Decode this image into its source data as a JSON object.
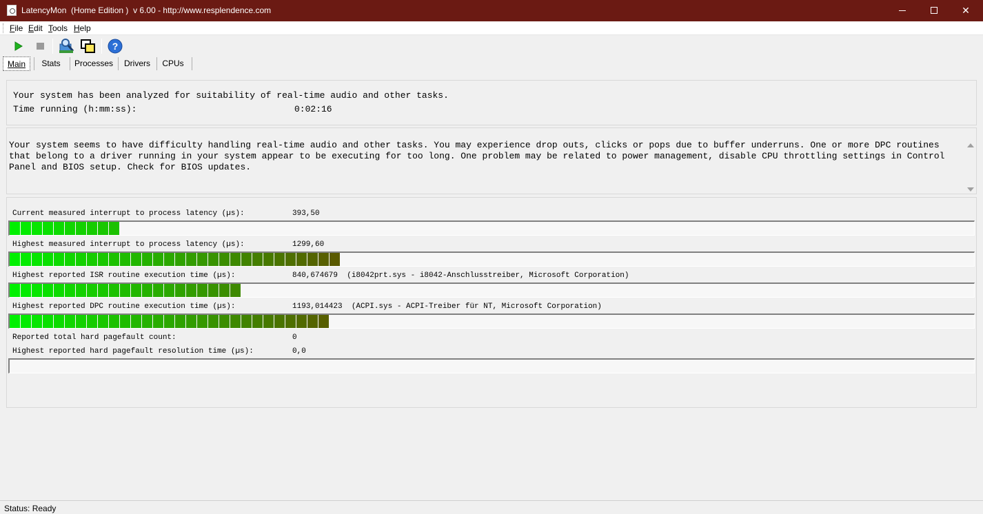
{
  "window": {
    "title": "LatencyMon  (Home Edition )  v 6.00 - http://www.resplendence.com",
    "close_glyph": "✕"
  },
  "menu": [
    {
      "underline": "F",
      "rest": "ile"
    },
    {
      "underline": "E",
      "rest": "dit"
    },
    {
      "underline": "T",
      "rest": "ools"
    },
    {
      "underline": "H",
      "rest": "elp"
    }
  ],
  "toolbar": {
    "icons": [
      "play-icon",
      "stop-icon",
      "analyze-icon",
      "windows-icon",
      "help-icon"
    ],
    "help_glyph": "?"
  },
  "tabs": [
    {
      "label": "Main",
      "active": true
    },
    {
      "label": "Stats",
      "active": false
    },
    {
      "label": "Processes",
      "active": false
    },
    {
      "label": "Drivers",
      "active": false
    },
    {
      "label": "CPUs",
      "active": false
    }
  ],
  "summary": {
    "line1": "Your system has been analyzed for suitability of real-time audio and other tasks.",
    "time_label": "Time running (h:mm:ss):",
    "time_value": "0:02:16"
  },
  "message": "Your system seems to have difficulty handling real-time audio and other tasks. You may experience drop outs, clicks or pops due to buffer underruns. One or more DPC routines that belong to a driver running in your system appear to be executing for too long. One problem may be related to power management, disable CPU throttling settings in Control Panel and BIOS setup. Check for BIOS updates.",
  "stats": {
    "current_latency": {
      "label": "Current measured interrupt to process latency (µs):",
      "value": "393,50",
      "segments": 10
    },
    "highest_latency": {
      "label": "Highest measured interrupt to process latency (µs):",
      "value": "1299,60",
      "segments": 30
    },
    "isr": {
      "label": "Highest reported ISR routine execution time (µs):",
      "value": "840,674679  (i8042prt.sys - i8042-Anschlusstreiber, Microsoft Corporation)",
      "segments": 21
    },
    "dpc": {
      "label": "Highest reported DPC routine execution time (µs):",
      "value": "1193,014423  (ACPI.sys - ACPI-Treiber für NT, Microsoft Corporation)",
      "segments": 29
    },
    "pagefault_count": {
      "label": "Reported total hard pagefault count:",
      "value": "0"
    },
    "pagefault_time": {
      "label": "Highest reported hard pagefault resolution time (µs):",
      "value": "0,0",
      "segments": 0
    }
  },
  "colors": {
    "bar_start": "#00f000",
    "bar_end": "#5a5a00",
    "titlebar": "#6b1a13"
  },
  "status": "Status: Ready"
}
